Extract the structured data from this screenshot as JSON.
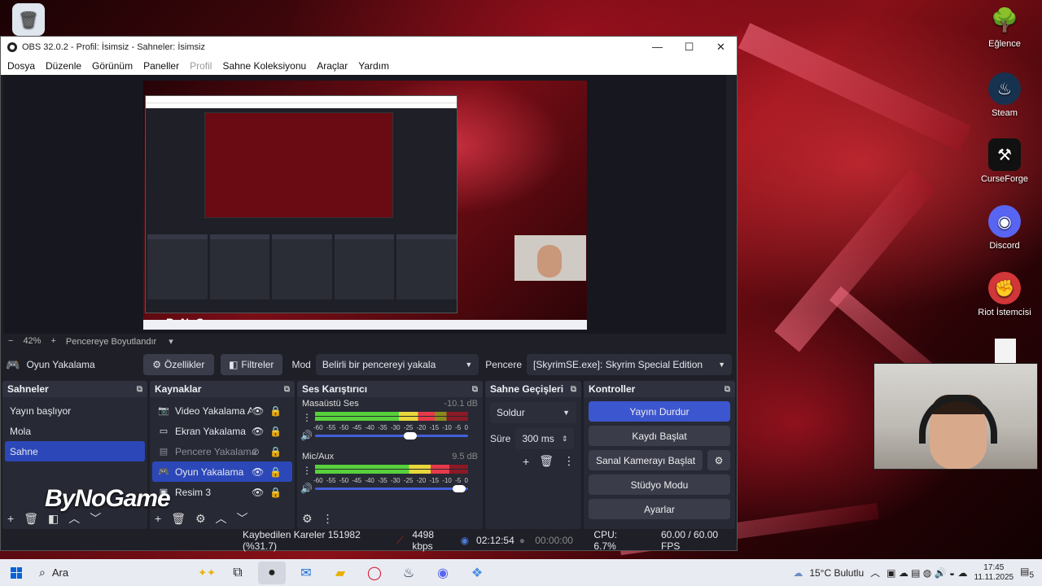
{
  "desktop": {
    "icons": [
      {
        "label": "",
        "glyph": "🗑"
      },
      {
        "label": "Eğlence",
        "glyph": "🌳"
      },
      {
        "label": "Steam",
        "glyph": "♨"
      },
      {
        "label": "CurseForge",
        "glyph": "⚒"
      },
      {
        "label": "Discord",
        "glyph": "◉"
      },
      {
        "label": "Riot İstemcisi",
        "glyph": "✊"
      }
    ]
  },
  "window": {
    "title": "OBS 32.0.2 - Profil: İsimsiz - Sahneler: İsimsiz",
    "minimize": "—",
    "maximize": "☐",
    "close": "✕"
  },
  "menu": {
    "items": [
      "Dosya",
      "Düzenle",
      "Görünüm",
      "Paneller",
      "Profil",
      "Sahne Koleksiyonu",
      "Araçlar",
      "Yardım"
    ]
  },
  "zoom": {
    "minus": "−",
    "value": "42%",
    "plus": "+",
    "fit_label": "Pencereye Boyutlandır"
  },
  "source_bar": {
    "source_name": "Oyun Yakalama",
    "properties": "Özellikler",
    "filters": "Filtreler",
    "mode_label": "Mod",
    "mode_value": "Belirli bir pencereyi yakala",
    "window_label": "Pencere",
    "window_value": "[SkyrimSE.exe]: Skyrim Special Edition"
  },
  "scenes": {
    "title": "Sahneler",
    "items": [
      "Yayın başlıyor",
      "Mola",
      "Sahne"
    ],
    "selected": 2
  },
  "sources": {
    "title": "Kaynaklar",
    "items": [
      {
        "label": "Video Yakalama Ay",
        "icon": "📷"
      },
      {
        "label": "Ekran Yakalama",
        "icon": "▭"
      },
      {
        "label": "Pencere Yakalama",
        "icon": "▤"
      },
      {
        "label": "Oyun Yakalama",
        "icon": "🎮"
      },
      {
        "label": "Resim 3",
        "icon": "▣"
      }
    ]
  },
  "mixer": {
    "title": "Ses Karıştırıcı",
    "channels": [
      {
        "name": "Masaüstü Ses",
        "db": "-10.1 dB",
        "level": 0.78,
        "volume": 0.62
      },
      {
        "name": "Mic/Aux",
        "db": "9.5 dB",
        "level": 0.88,
        "volume": 0.94
      }
    ],
    "ticks": [
      "-60",
      "-55",
      "-50",
      "-45",
      "-40",
      "-35",
      "-30",
      "-25",
      "-20",
      "-15",
      "-10",
      "-5",
      "0"
    ]
  },
  "transitions": {
    "title": "Sahne Geçişleri",
    "type": "Soldur",
    "duration_label": "Süre",
    "duration_value": "300 ms"
  },
  "controls": {
    "title": "Kontroller",
    "stop_stream": "Yayını Durdur",
    "start_recording": "Kaydı Başlat",
    "virtual_cam": "Sanal Kamerayı Başlat",
    "studio_mode": "Stüdyo Modu",
    "settings": "Ayarlar"
  },
  "status": {
    "dropped_frames": "Kaybedilen Kareler 151982 (%31.7)",
    "bitrate": "4498 kbps",
    "stream_time": "02:12:54",
    "record_time": "00:00:00",
    "cpu": "CPU: 6.7%",
    "fps": "60.00 / 60.00 FPS"
  },
  "overlay": {
    "brand": "ByNoGame"
  },
  "taskbar": {
    "search_placeholder": "Ara",
    "weather": "15°C Bulutlu",
    "time": "17:45",
    "date": "11.11.2025",
    "notifications": "5"
  },
  "colors": {
    "accent": "#3c56cf",
    "selection": "#2c48b8",
    "panel": "#272934"
  }
}
